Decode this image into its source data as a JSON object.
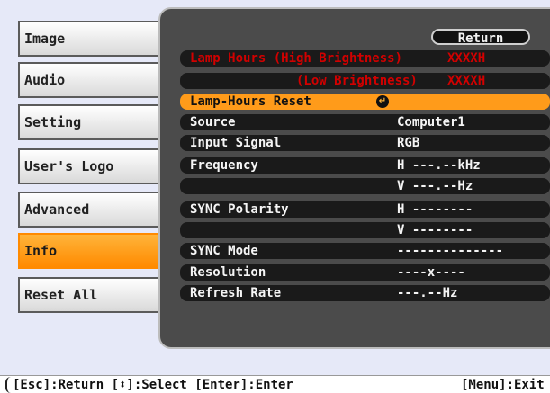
{
  "menu": {
    "items": [
      {
        "label": "Image"
      },
      {
        "label": "Audio"
      },
      {
        "label": "Setting"
      },
      {
        "label": "User's Logo"
      },
      {
        "label": "Advanced"
      },
      {
        "label": "Info"
      },
      {
        "label": "Reset All"
      }
    ]
  },
  "panel": {
    "return_label": "Return",
    "lamp_hours_high_label": "Lamp Hours (High Brightness)",
    "lamp_hours_high_value": "XXXXH",
    "lamp_hours_low_label": "(Low Brightness)",
    "lamp_hours_low_value": "XXXXH",
    "lamp_reset_label": "Lamp-Hours Reset",
    "rows": [
      {
        "label": "Source",
        "value": "Computer1"
      },
      {
        "label": "Input Signal",
        "value": "RGB"
      },
      {
        "label": "Frequency",
        "value": "H ---.--kHz",
        "value2": "V ---.--Hz"
      },
      {
        "label": "SYNC Polarity",
        "value": "H --------",
        "value2": "V --------"
      },
      {
        "label": "SYNC Mode",
        "value": "--------------"
      },
      {
        "label": "Resolution",
        "value": "----x----"
      },
      {
        "label": "Refresh Rate",
        "value": "---.--Hz"
      }
    ]
  },
  "footer": {
    "hint_left": "[Esc]:Return [⬍]:Select [Enter]:Enter",
    "hint_right": "[Menu]:Exit"
  },
  "colors": {
    "accent": "#ff9b1a",
    "panel_bg": "#4b4b4b",
    "warning_text": "#d20000"
  }
}
